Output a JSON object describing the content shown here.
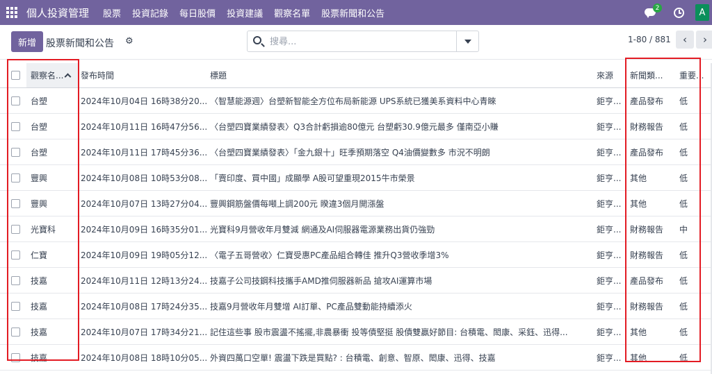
{
  "nav": {
    "brand": "個人投資管理",
    "items": [
      "股票",
      "投資記錄",
      "每日股價",
      "投資建議",
      "觀察名單",
      "股票新聞和公告"
    ],
    "chat_badge": "2",
    "avatar_letter": "A"
  },
  "control": {
    "new_label": "新增",
    "title": "股票新聞和公告",
    "search_placeholder": "搜尋...",
    "pager": "1-80 / 881",
    "prev": "‹",
    "next": "›"
  },
  "table": {
    "headers": {
      "name": "觀察名...",
      "time": "發布時間",
      "title": "標題",
      "source": "來源",
      "type": "新聞類...",
      "importance": "重要..."
    },
    "rows": [
      {
        "name": "台塑",
        "time": "2024年10月04日 16時38分20...",
        "title": "〈智慧能源週〉台塑新智能全方位布局新能源 UPS系統已獲美系資料中心青睞",
        "source": "鉅亨...",
        "type": "產品發布",
        "importance": "低"
      },
      {
        "name": "台塑",
        "time": "2024年10月11日 16時47分56...",
        "title": "〈台塑四寶業績發表〉Q3合計虧損逾80億元 台塑虧30.9億元最多 僅南亞小賺",
        "source": "鉅亨...",
        "type": "財務報告",
        "importance": "低"
      },
      {
        "name": "台塑",
        "time": "2024年10月11日 17時45分36...",
        "title": "〈台塑四寶業績發表〉「金九銀十」旺季預期落空 Q4油價變數多 市況不明朗",
        "source": "鉅亨...",
        "type": "產品發布",
        "importance": "低"
      },
      {
        "name": "豐興",
        "time": "2024年10月08日 10時53分08...",
        "title": "「賣印度、買中國」成顯學 A股可望重現2015牛市榮景",
        "source": "鉅亨...",
        "type": "其他",
        "importance": "低"
      },
      {
        "name": "豐興",
        "time": "2024年10月07日 13時27分04...",
        "title": "豐興鋼筋盤價每噸上調200元 睽違3個月開漲盤",
        "source": "鉅亨...",
        "type": "其他",
        "importance": "低"
      },
      {
        "name": "光寶科",
        "time": "2024年10月09日 16時35分01...",
        "title": "光寶科9月營收年月雙減 網通及AI伺服器電源業務出貨仍強勁",
        "source": "鉅亨...",
        "type": "財務報告",
        "importance": "中"
      },
      {
        "name": "仁寶",
        "time": "2024年10月09日 19時05分12...",
        "title": "〈電子五哥營收〉仁寶受惠PC產品組合轉佳 推升Q3營收季增3%",
        "source": "鉅亨...",
        "type": "財務報告",
        "importance": "低"
      },
      {
        "name": "技嘉",
        "time": "2024年10月11日 12時13分24...",
        "title": "技嘉子公司技鋼科技攜手AMD推伺服器新品 搶攻AI運算市場",
        "source": "鉅亨...",
        "type": "產品發布",
        "importance": "低"
      },
      {
        "name": "技嘉",
        "time": "2024年10月08日 17時24分35...",
        "title": "技嘉9月營收年月雙增 AI訂單、PC產品雙動能持續添火",
        "source": "鉅亨...",
        "type": "財務報告",
        "importance": "低"
      },
      {
        "name": "技嘉",
        "time": "2024年10月07日 17時34分21...",
        "title": "記住這些事 股市震盪不搖擺,非農暴衝 投等債堅挺 股債雙贏好節目: 台積電、閎康、采鈺、迅得...",
        "source": "鉅亨...",
        "type": "其他",
        "importance": "低"
      },
      {
        "name": "技嘉",
        "time": "2024年10月08日 18時10分05...",
        "title": "外資四萬口空單! 震盪下跌是買點? : 台積電、創意、智原、閎康、迅得、技嘉",
        "source": "鉅亨...",
        "type": "其他",
        "importance": "低"
      }
    ]
  },
  "colors": {
    "nav_bg": "#71639e",
    "badge": "#28a745",
    "avatar": "#0a8f5b",
    "highlight": "#e31b23"
  }
}
